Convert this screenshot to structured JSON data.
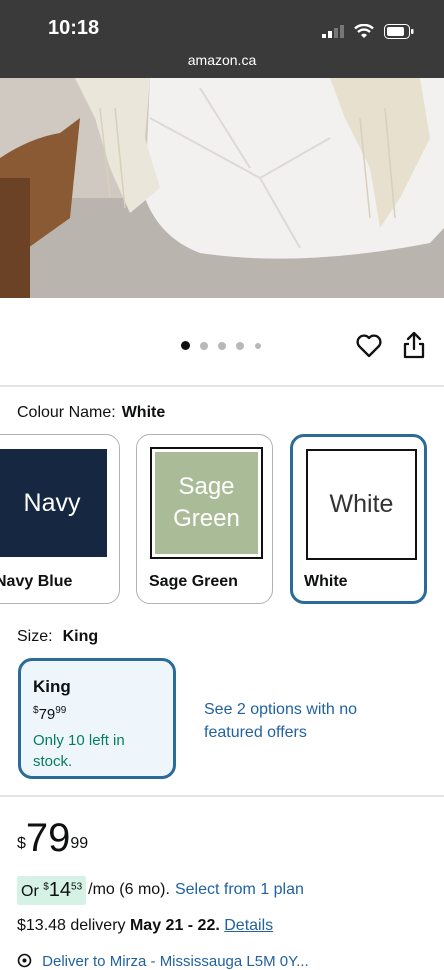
{
  "status": {
    "time": "10:18",
    "url": "amazon.ca"
  },
  "carousel": {
    "dots": 5,
    "active": 0
  },
  "colour": {
    "label": "Colour Name:",
    "value": "White",
    "options": [
      {
        "tile_text": "Navy",
        "name": "Navy Blue",
        "color": "#162841",
        "text_color": "#ffffff"
      },
      {
        "tile_text": "Sage Green",
        "tile_line1": "Sage",
        "tile_line2": "Green",
        "name": "Sage Green",
        "color": "#a9bc97",
        "text_color": "#ffffff"
      },
      {
        "tile_text": "White",
        "name": "White",
        "color": "#ffffff",
        "text_color": "#333333"
      }
    ]
  },
  "size": {
    "label": "Size:",
    "value": "King",
    "card": {
      "title": "King",
      "price_currency": "$",
      "price_whole": "79",
      "price_cents": "99",
      "stock": "Only 10 left in stock."
    },
    "options_link": "See 2 options with no featured offers"
  },
  "price": {
    "currency": "$",
    "whole": "79",
    "cents": "99"
  },
  "plan": {
    "prefix": "Or ",
    "currency": "$",
    "whole": "14",
    "cents": "53",
    "suffix": "/mo (6 mo).",
    "link": "Select from 1 plan"
  },
  "delivery": {
    "text": "$13.48 delivery",
    "dates": "May 21 - 22.",
    "link": "Details"
  },
  "deliver_to": {
    "text": "Deliver to Mirza - Mississauga L5M 0Y..."
  },
  "colors": {
    "accent": "#2a6b99",
    "link": "#2162a1",
    "stock_green": "#067d62",
    "plan_highlight": "#d6f2e6"
  }
}
